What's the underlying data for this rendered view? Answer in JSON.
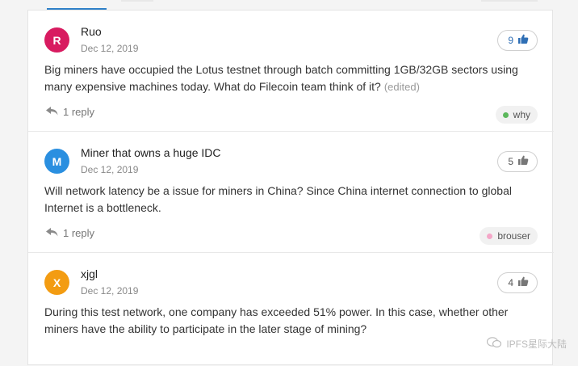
{
  "questions": [
    {
      "avatar_letter": "R",
      "avatar_color": "#d81b60",
      "author": "Ruo",
      "date": "Dec 12, 2019",
      "votes": "9",
      "voted": true,
      "body": "Big miners have occupied the Lotus testnet through batch committing 1GB/32GB sectors using many expensive machines today. What do Filecoin team think of it?",
      "edited": "(edited)",
      "replies": "1 reply",
      "tag": "why",
      "tag_color": "#5cb85c"
    },
    {
      "avatar_letter": "M",
      "avatar_color": "#2a8fe0",
      "author": "Miner that owns a huge IDC",
      "date": "Dec 12, 2019",
      "votes": "5",
      "voted": false,
      "body": "Will network latency be a issue for miners in China? Since China internet connection to global Internet is a bottleneck.",
      "replies": "1 reply",
      "tag": "brouser",
      "tag_color": "#f4a7c8"
    },
    {
      "avatar_letter": "X",
      "avatar_color": "#f39c12",
      "author": "xjgl",
      "date": "Dec 12, 2019",
      "votes": "4",
      "voted": false,
      "body": "During this test network, one company has exceeded 51% power. In this case, whether other miners have the ability to participate in the later stage of mining?"
    }
  ],
  "watermark": "IPFS星际大陆",
  "icons": {
    "like": "thumbs-up-icon",
    "reply": "reply-arrow-icon",
    "watermark": "wechat-icon"
  }
}
